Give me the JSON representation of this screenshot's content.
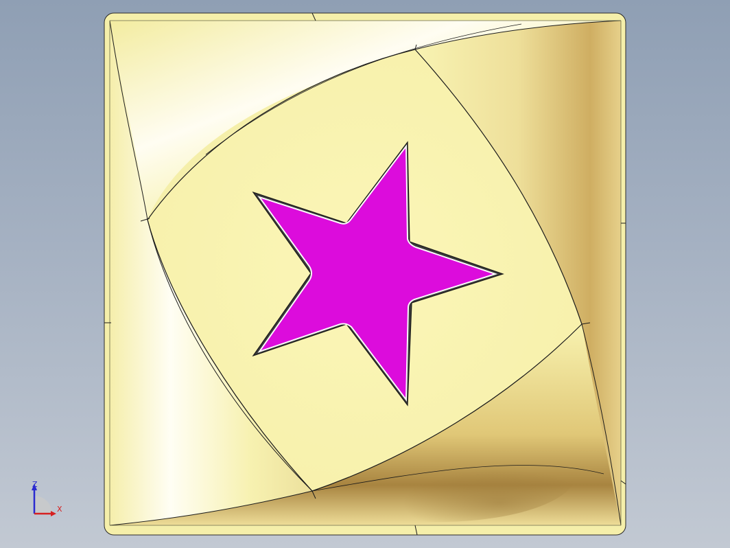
{
  "scene": {
    "background_top": "#8f9fb4",
    "background_bottom": "#c2c9d3",
    "part_color": "#f6f1ad",
    "part_highlight": "#fffef0",
    "part_shadow": "#c9a85a",
    "edge_color": "#1a1a1a",
    "star_color": "#dc0cdc"
  },
  "triad": {
    "x_label": "X",
    "z_label": "Z",
    "x_color": "#d62020",
    "z_color": "#2a2ad0",
    "y_color": "#a8a8a8"
  }
}
